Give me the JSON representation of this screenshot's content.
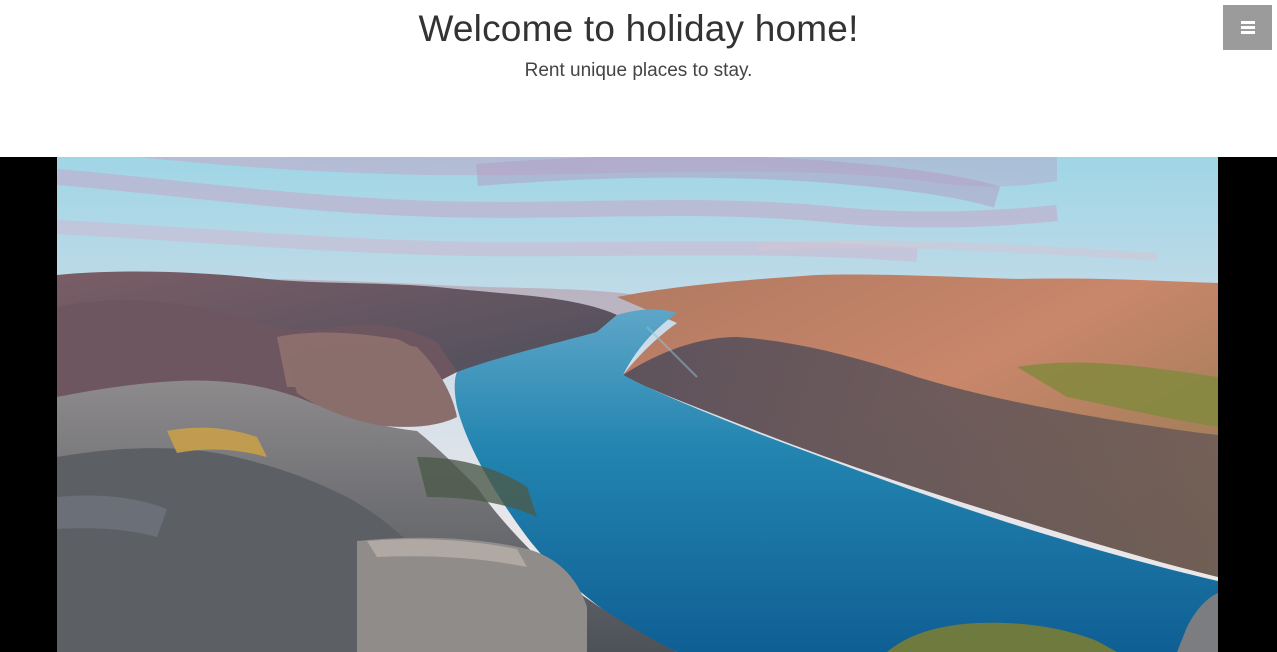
{
  "header": {
    "title": "Welcome to holiday home!",
    "subtitle": "Rent unique places to stay."
  },
  "nav": {
    "menu_icon": "hamburger-menu-icon",
    "menu_button_color": "#9b9b9b"
  },
  "hero": {
    "image_description": "fjord-landscape",
    "background_color": "#000000"
  },
  "colors": {
    "title": "#333333",
    "subtitle": "#444444",
    "water": "#1f7fa8"
  }
}
